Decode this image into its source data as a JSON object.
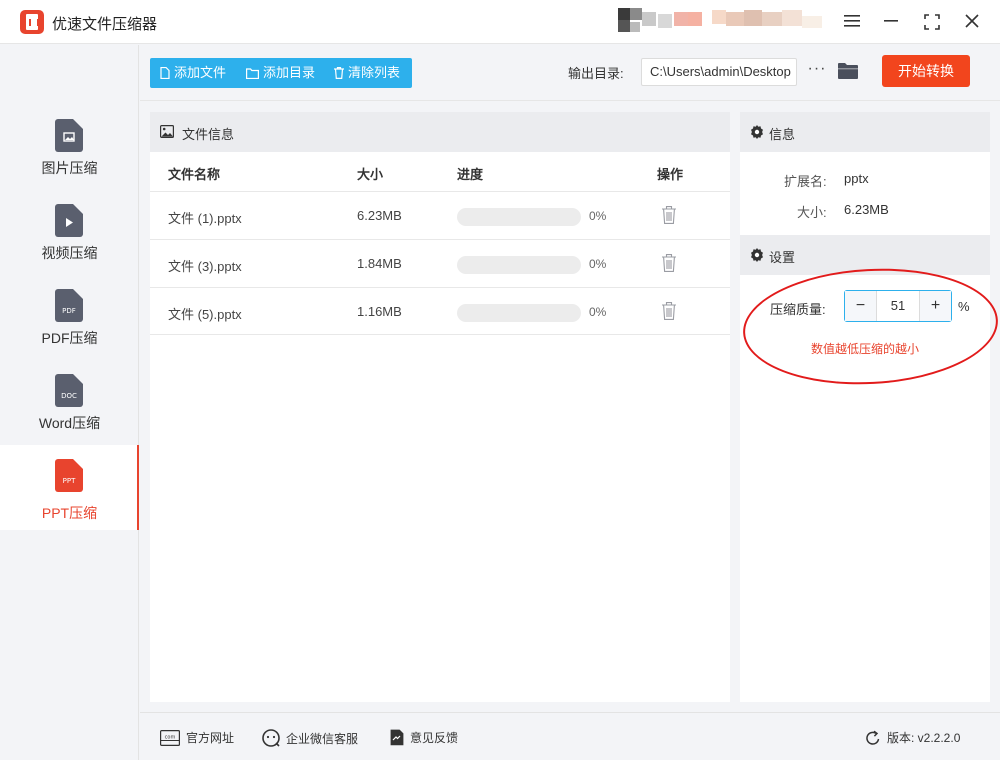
{
  "app": {
    "title": "优速文件压缩器"
  },
  "sidebar": {
    "items": [
      {
        "label": "图片压缩",
        "icon": "image-file-icon",
        "tag": ""
      },
      {
        "label": "视频压缩",
        "icon": "video-file-icon",
        "tag": ""
      },
      {
        "label": "PDF压缩",
        "icon": "pdf-file-icon",
        "tag": "PDF"
      },
      {
        "label": "Word压缩",
        "icon": "doc-file-icon",
        "tag": "DOC"
      },
      {
        "label": "PPT压缩",
        "icon": "ppt-file-icon",
        "tag": "PPT",
        "active": true
      }
    ]
  },
  "toolbar": {
    "add_file": "添加文件",
    "add_dir": "添加目录",
    "clear_list": "清除列表",
    "output_label": "输出目录:",
    "output_path": "C:\\Users\\admin\\Desktop",
    "more": "···",
    "start": "开始转换"
  },
  "file_panel": {
    "title": "文件信息",
    "columns": [
      "文件名称",
      "大小",
      "进度",
      "操作"
    ],
    "rows": [
      {
        "name": "文件 (1).pptx",
        "size": "6.23MB",
        "progress": 0,
        "progress_text": "0%"
      },
      {
        "name": "文件 (3).pptx",
        "size": "1.84MB",
        "progress": 0,
        "progress_text": "0%"
      },
      {
        "name": "文件 (5).pptx",
        "size": "1.16MB",
        "progress": 0,
        "progress_text": "0%"
      }
    ]
  },
  "info_panel": {
    "title": "信息",
    "ext_label": "扩展名:",
    "ext_value": "pptx",
    "size_label": "大小:",
    "size_value": "6.23MB"
  },
  "settings_panel": {
    "title": "设置",
    "quality_label": "压缩质量:",
    "quality_value": "51",
    "minus": "−",
    "plus": "+",
    "unit": "%",
    "hint": "数值越低压缩的越小"
  },
  "footer": {
    "website": "官方网址",
    "wechat": "企业微信客服",
    "feedback": "意见反馈",
    "version": "版本: v2.2.2.0"
  },
  "colors": {
    "accent": "#2db0ec",
    "brand": "#e8442e",
    "start": "#f2451d",
    "icon_gray": "#5a5f6e"
  }
}
